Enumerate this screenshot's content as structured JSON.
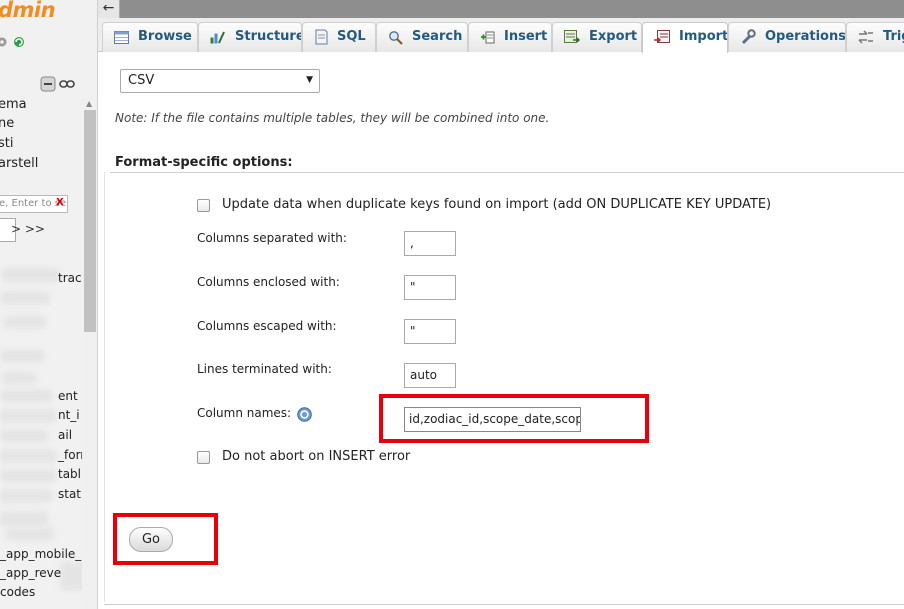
{
  "app": {
    "logo_text": "dmin",
    "back_arrow": "←"
  },
  "navigation": {
    "databases": [
      "ema",
      "ne",
      "sti",
      "arstell"
    ],
    "filter_placeholder": "e, Enter to se",
    "filter_clear": "X",
    "pager_label": "> >>",
    "table_fragments": [
      "track",
      "ent",
      "nt_i",
      "ail",
      "_forr",
      "tabl",
      "statu",
      "_app_mobile_",
      "_app_reve",
      "codes"
    ]
  },
  "tabs": [
    {
      "label": "Browse",
      "icon": "browse-icon"
    },
    {
      "label": "Structure",
      "icon": "structure-icon"
    },
    {
      "label": "SQL",
      "icon": "sql-icon"
    },
    {
      "label": "Search",
      "icon": "search-icon"
    },
    {
      "label": "Insert",
      "icon": "insert-icon"
    },
    {
      "label": "Export",
      "icon": "export-icon"
    },
    {
      "label": "Import",
      "icon": "import-icon",
      "active": true
    },
    {
      "label": "Operations",
      "icon": "operations-icon"
    },
    {
      "label": "Trig",
      "icon": "triggers-icon"
    }
  ],
  "import": {
    "format_selected": "CSV",
    "note": "Note: If the file contains multiple tables, they will be combined into one.",
    "format_options_title": "Format-specific options:",
    "update_duplicates_label": "Update data when duplicate keys found on import (add ON DUPLICATE KEY UPDATE)",
    "update_duplicates_checked": false,
    "columns_separated_label": "Columns separated with:",
    "columns_separated_value": ",",
    "columns_enclosed_label": "Columns enclosed with:",
    "columns_enclosed_value": "\"",
    "columns_escaped_label": "Columns escaped with:",
    "columns_escaped_value": "\"",
    "lines_terminated_label": "Lines terminated with:",
    "lines_terminated_value": "auto",
    "column_names_label": "Column names:",
    "column_names_value": "id,zodiac_id,scope_date,scope",
    "do_not_abort_label": "Do not abort on INSERT error",
    "do_not_abort_checked": false,
    "go_label": "Go"
  },
  "colors": {
    "accent": "#235a81",
    "highlight": "#e8000b",
    "logo": "#f58b1e"
  }
}
